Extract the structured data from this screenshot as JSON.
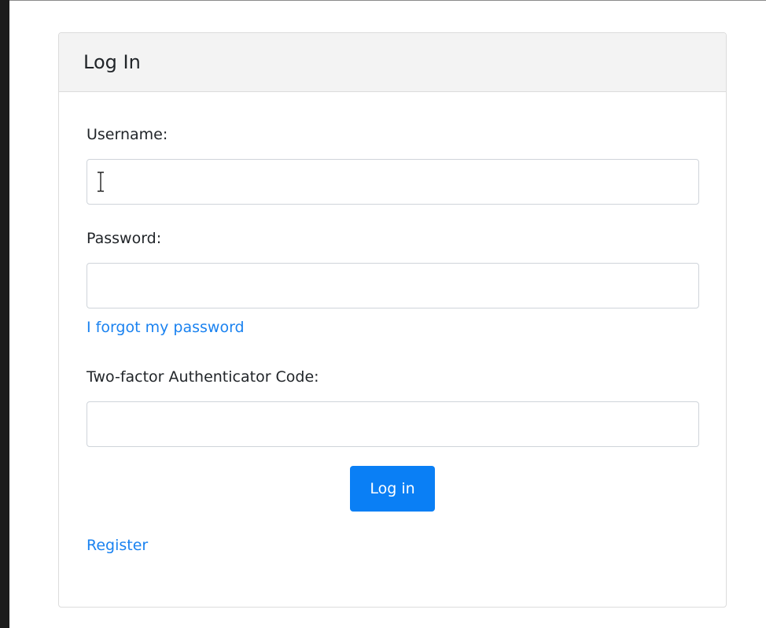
{
  "header": {
    "title": "Log In"
  },
  "form": {
    "username_label": "Username:",
    "username_value": "",
    "password_label": "Password:",
    "password_value": "",
    "forgot_link": "I forgot my password",
    "twofactor_label": "Two-factor Authenticator Code:",
    "twofactor_value": "",
    "login_button": "Log in",
    "register_link": "Register"
  },
  "icons": {
    "cursor": "text-cursor-icon"
  },
  "colors": {
    "accent": "#0a7ff5",
    "link": "#1a82f0",
    "header_bg": "#f3f3f3",
    "border": "#dcdcdc"
  }
}
